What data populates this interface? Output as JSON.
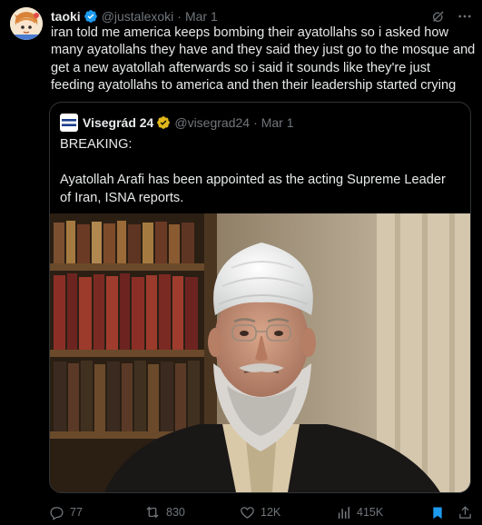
{
  "author": {
    "name": "taoki",
    "handle": "@justalexoki",
    "date": "Mar 1",
    "avatar_icon": "anime-character-avatar-icon"
  },
  "tweet_text": "iran told me america keeps bombing their ayatollahs so i asked how many ayatollahs they have and they said they just go to the mosque and get a new ayatollah afterwards so i said it sounds like they're just feeding ayatollahs to america and then their leadership started crying",
  "quoted": {
    "name": "Visegrád 24",
    "handle": "@visegrad24",
    "date": "Mar 1",
    "line1": "BREAKING:",
    "line2": "Ayatollah Arafi has been appointed as the acting Supreme Leader of Iran, ISNA reports.",
    "photo_icon": "cleric-portrait-photo"
  },
  "stats": {
    "replies": "77",
    "reposts": "830",
    "likes": "12K",
    "views": "415K"
  },
  "colors": {
    "background": "#000000",
    "text": "#e7e9ea",
    "muted": "#71767b",
    "verified_blue": "#1d9bf0",
    "gold_badge": "#e2b719",
    "border": "#2f3336"
  }
}
